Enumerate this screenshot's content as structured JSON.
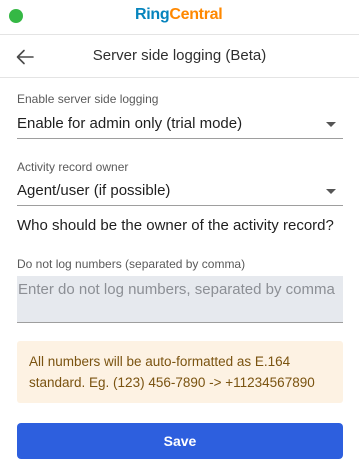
{
  "colors": {
    "status_dot": "#35b845",
    "primary_button": "#2d5fde",
    "note_background": "#fdf2e3",
    "note_text": "#7a5310",
    "brand_blue": "#0684bd",
    "brand_orange": "#ff8800"
  },
  "topbar": {
    "logo_ring": "Ring",
    "logo_central": "Central",
    "status_icon": "green-dot"
  },
  "header": {
    "back_icon": "arrow-left-icon",
    "title": "Server side logging (Beta)"
  },
  "fields": {
    "enable_logging": {
      "label": "Enable server side logging",
      "value": "Enable for admin only (trial mode)"
    },
    "activity_owner": {
      "label": "Activity record owner",
      "value": "Agent/user (if possible)",
      "helper": "Who should be the owner of the activity record?"
    },
    "do_not_log": {
      "label": "Do not log numbers (separated by comma)",
      "placeholder": "Enter do not log numbers, separated by comma",
      "value": ""
    }
  },
  "note": {
    "text": "All numbers will be auto-formatted as E.164 standard. Eg. (123) 456-7890 -> +11234567890"
  },
  "actions": {
    "save_label": "Save"
  }
}
